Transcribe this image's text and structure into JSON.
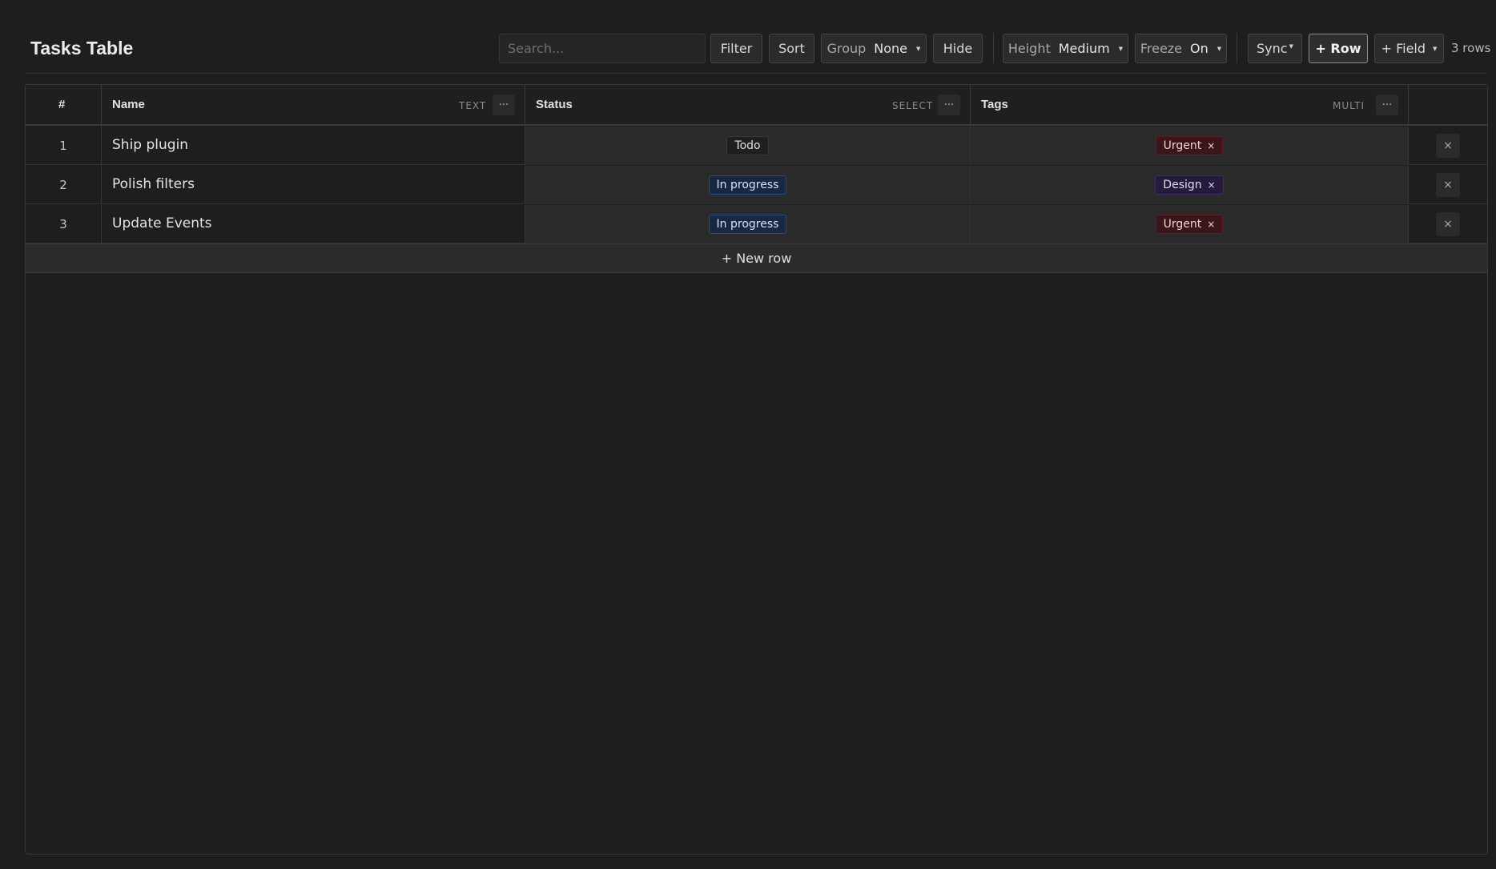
{
  "title": "Tasks Table",
  "toolbar": {
    "search_placeholder": "Search...",
    "filter_label": "Filter",
    "sort_label": "Sort",
    "group_label": "Group",
    "group_value": "None",
    "hide_label": "Hide",
    "height_label": "Height",
    "height_value": "Medium",
    "freeze_label": "Freeze",
    "freeze_value": "On",
    "sync_label": "Sync",
    "add_row_label": "+ Row",
    "add_field_label": "+ Field",
    "row_count": "3 rows"
  },
  "columns": [
    {
      "label": "#"
    },
    {
      "label": "Name",
      "type": "TEXT",
      "menu": "···"
    },
    {
      "label": "Status",
      "type": "SELECT",
      "menu": "···"
    },
    {
      "label": "Tags",
      "type": "MULTI",
      "menu": "···"
    }
  ],
  "rows": [
    {
      "num": "1",
      "name": "Ship plugin",
      "status": "Todo",
      "tag": "Urgent",
      "tag_remove": "×",
      "delete": "×"
    },
    {
      "num": "2",
      "name": "Polish filters",
      "status": "In progress",
      "tag": "Design",
      "tag_remove": "×",
      "delete": "×"
    },
    {
      "num": "3",
      "name": "Update Events",
      "status": "In progress",
      "tag": "Urgent",
      "tag_remove": "×",
      "delete": "×"
    }
  ],
  "new_row_label": "+ New row",
  "icons": {
    "caret": "caret-down-icon",
    "menu": "more-horizontal-icon",
    "remove": "close-icon"
  },
  "colors": {
    "background": "#1e1e1e",
    "status_in_progress": "#182742",
    "tag_urgent": "#3a1519",
    "tag_design": "#261a3c"
  }
}
